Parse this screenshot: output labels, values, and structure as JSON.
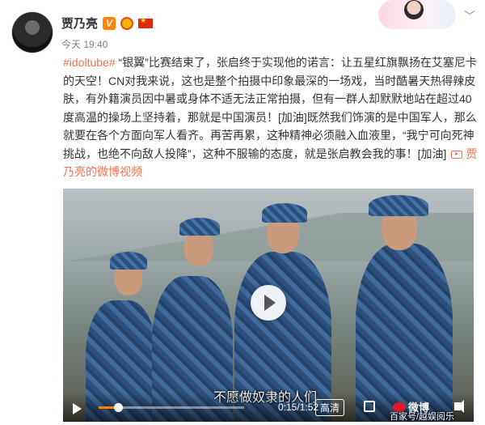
{
  "author": {
    "name": "贾乃亮",
    "verified_badge": "V",
    "timestamp": "今天 19:40"
  },
  "post": {
    "hashtag": "#idoltube#",
    "text_main": " “银翼”比赛结束了，张启终于实现他的诺言：让五星红旗飘扬在艾塞尼卡的天空！CN对我来说，这也是整个拍摄中印象最深的一场戏，当时酷暑天热得辣皮肤，有外籍演员因中暑或身体不适无法正常拍摄，但有一群人却默默地站在超过40度高温的操场上坚持着，那就是中国演员！[加油]既然我们饰演的是中国军人，那么就要在各个方面向军人看齐。再苦再累，这种精神必须融入血液里，“我宁可向死神挑战，也绝不向敌人投降”，这种不服输的态度，就是张启教会我的事！[加油] ",
    "video_link_label": "贾乃亮的微博视频"
  },
  "video": {
    "subtitle": "不愿做奴隶的人们",
    "time": "0:15/1:52",
    "quality_label": "高清",
    "watermark": "微博",
    "progress_fraction": 0.134
  },
  "watermark_source": "百家号/越娱阅乐",
  "colors": {
    "accent": "#eb7350",
    "progress": "#ff8200",
    "weibo_red": "#e6162d"
  },
  "icons": [
    "verified-v-icon",
    "medal-icon",
    "china-flag-icon",
    "chevron-down-icon",
    "video-link-icon",
    "play-icon",
    "fullscreen-icon",
    "volume-icon",
    "weibo-logo-icon"
  ]
}
